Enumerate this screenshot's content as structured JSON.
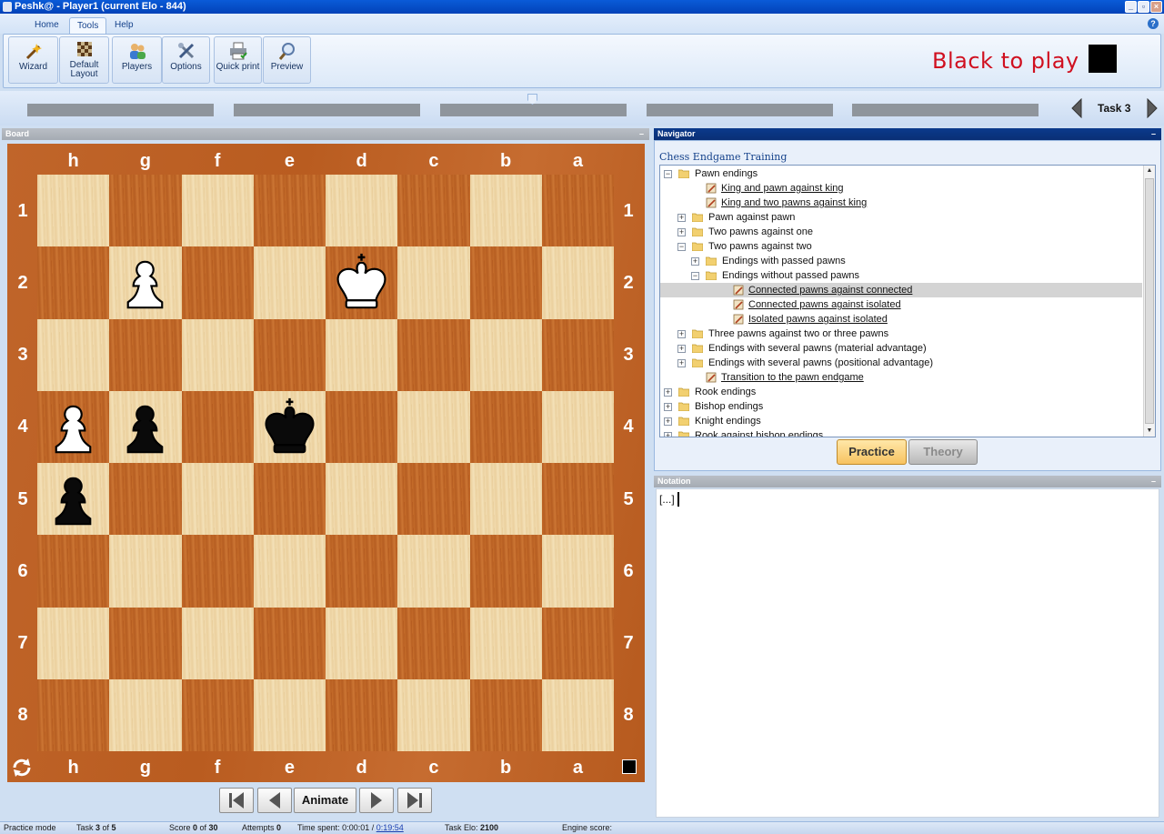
{
  "window": {
    "title": "Peshk@ - Player1 (current Elo - 844)"
  },
  "ribbon": {
    "tabs": [
      "Home",
      "Tools",
      "Help"
    ],
    "active_tab": "Tools",
    "buttons": {
      "wizard": "Wizard",
      "default_layout_1": "Default",
      "default_layout_2": "Layout",
      "players": "Players",
      "options": "Options",
      "quick_print": "Quick print",
      "preview": "Preview"
    },
    "to_move": "Black to play"
  },
  "task": {
    "label": "Task 3",
    "current": 3,
    "total": 5
  },
  "board": {
    "title": "Board",
    "files": [
      "h",
      "g",
      "f",
      "e",
      "d",
      "c",
      "b",
      "a"
    ],
    "ranks": [
      "1",
      "2",
      "3",
      "4",
      "5",
      "6",
      "7",
      "8"
    ],
    "pieces": [
      {
        "square": "g2",
        "piece": "white-pawn"
      },
      {
        "square": "d2",
        "piece": "white-king"
      },
      {
        "square": "h4",
        "piece": "white-pawn"
      },
      {
        "square": "g4",
        "piece": "black-pawn"
      },
      {
        "square": "e4",
        "piece": "black-king"
      },
      {
        "square": "h5",
        "piece": "black-pawn"
      }
    ],
    "controls": {
      "animate": "Animate"
    }
  },
  "navigator": {
    "title": "Navigator",
    "heading": "Chess Endgame Training",
    "tree": [
      {
        "level": 0,
        "type": "folder",
        "expander": "-",
        "label": "Pawn endings"
      },
      {
        "level": 1,
        "type": "lesson",
        "label": "King and pawn against king"
      },
      {
        "level": 1,
        "type": "lesson",
        "label": "King and two pawns against king"
      },
      {
        "level": 1,
        "type": "folder",
        "expander": "+",
        "label": "Pawn against pawn"
      },
      {
        "level": 1,
        "type": "folder",
        "expander": "+",
        "label": "Two pawns against one"
      },
      {
        "level": 1,
        "type": "folder",
        "expander": "-",
        "label": "Two pawns against two"
      },
      {
        "level": 2,
        "type": "folder",
        "expander": "+",
        "label": "Endings with passed pawns"
      },
      {
        "level": 2,
        "type": "folder",
        "expander": "-",
        "label": "Endings without passed pawns"
      },
      {
        "level": 3,
        "type": "lesson",
        "label": "Connected pawns against connected",
        "selected": true
      },
      {
        "level": 3,
        "type": "lesson",
        "label": "Connected pawns against isolated"
      },
      {
        "level": 3,
        "type": "lesson",
        "label": "Isolated pawns against isolated"
      },
      {
        "level": 1,
        "type": "folder",
        "expander": "+",
        "label": "Three pawns against two or three pawns"
      },
      {
        "level": 1,
        "type": "folder",
        "expander": "+",
        "label": "Endings with several pawns (material advantage)"
      },
      {
        "level": 1,
        "type": "folder",
        "expander": "+",
        "label": "Endings with several pawns (positional advantage)"
      },
      {
        "level": 1,
        "type": "lesson",
        "label": "Transition to the pawn endgame"
      },
      {
        "level": 0,
        "type": "folder",
        "expander": "+",
        "label": "Rook endings"
      },
      {
        "level": 0,
        "type": "folder",
        "expander": "+",
        "label": "Bishop endings"
      },
      {
        "level": 0,
        "type": "folder",
        "expander": "+",
        "label": "Knight endings"
      },
      {
        "level": 0,
        "type": "folder",
        "expander": "+",
        "label": "Rook against bishop endings"
      }
    ],
    "practice": "Practice",
    "theory": "Theory"
  },
  "notation": {
    "title": "Notation",
    "text": "[...]"
  },
  "status": {
    "mode": "Practice mode",
    "task_prefix": "Task ",
    "task_current": "3",
    "task_of": " of ",
    "task_total": "5",
    "score_prefix": "Score ",
    "score_value": "0",
    "score_of": " of ",
    "score_total": "30",
    "attempts_prefix": "Attempts ",
    "attempts_value": "0",
    "time_prefix": "Time spent: 0:00:01 / ",
    "time_limit": "0:19:54",
    "elo_prefix": "Task Elo: ",
    "elo_value": "2100",
    "engine": "Engine score:"
  },
  "colors": {
    "accent": "#d01020",
    "board_frame": "#bf6329",
    "light_square": "#f0d9ab",
    "dark_square": "#bf6628"
  },
  "icons": [
    "wizard-icon",
    "default-layout-icon",
    "players-icon",
    "options-icon",
    "quick-print-icon",
    "preview-icon",
    "folder-icon",
    "lesson-icon",
    "flip-board-icon",
    "first-move-icon",
    "prev-move-icon",
    "next-move-icon",
    "last-move-icon"
  ]
}
